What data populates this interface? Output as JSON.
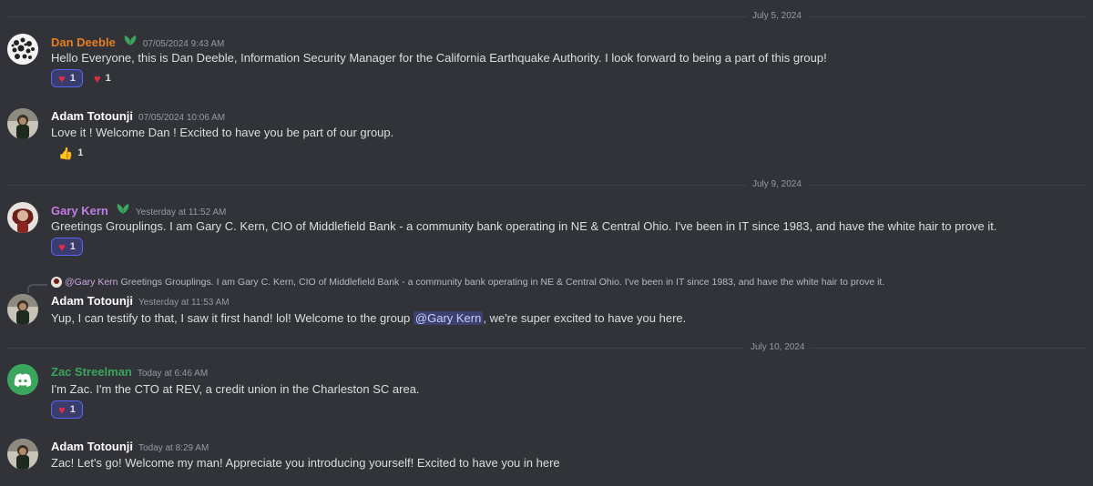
{
  "dividers": [
    "July 5, 2024",
    "July 9, 2024",
    "July 10, 2024"
  ],
  "messages": [
    {
      "username": "Dan Deeble",
      "username_color": "#e67e22",
      "timestamp": "07/05/2024 9:43 AM",
      "text": "Hello Everyone, this is Dan Deeble, Information Security Manager for the California Earthquake Authority. I look forward to being a part of this group!",
      "reactions": [
        {
          "emoji": "heart",
          "count": "1"
        },
        {
          "emoji": "heart",
          "count": "1"
        }
      ]
    },
    {
      "username": "Adam Totounji",
      "username_color": "#ffffff",
      "timestamp": "07/05/2024 10:06 AM",
      "text": "Love it ! Welcome Dan ! Excited to have you be part of our group.",
      "reactions": [
        {
          "emoji": "thumbs-up",
          "count": "1"
        }
      ]
    },
    {
      "username": "Gary Kern",
      "username_color": "#c27ce6",
      "timestamp": "Yesterday at 11:52 AM",
      "text": "Greetings Grouplings.  I am Gary C. Kern, CIO of Middlefield Bank - a community bank operating in NE & Central Ohio.  I've been in IT since 1983, and have the white hair to prove it.",
      "reactions": [
        {
          "emoji": "heart",
          "count": "1"
        }
      ]
    },
    {
      "reply_to_name": "@Gary Kern",
      "reply_to_text": "Greetings Grouplings.  I am Gary C. Kern, CIO of Middlefield Bank - a community bank operating in NE & Central Ohio.  I've been in IT since 1983, and have the white hair to prove it.",
      "username": "Adam Totounji",
      "username_color": "#ffffff",
      "timestamp": "Yesterday at 11:53 AM",
      "text_before": "Yup, I can testify to that, I saw it first hand! lol! Welcome to the group ",
      "mention": "@Gary Kern",
      "text_after": ", we're super excited to have you here."
    },
    {
      "username": "Zac Streelman",
      "username_color": "#3ba55d",
      "timestamp": "Today at 6:46 AM",
      "text": "I'm Zac. I'm the CTO at REV, a credit union in the Charleston SC area.",
      "reactions": [
        {
          "emoji": "heart",
          "count": "1"
        }
      ]
    },
    {
      "username": "Adam Totounji",
      "username_color": "#ffffff",
      "timestamp": "Today at 8:29 AM",
      "text": "Zac! Let's go! Welcome my man! Appreciate you introducing yourself! Excited to have you in here"
    }
  ]
}
